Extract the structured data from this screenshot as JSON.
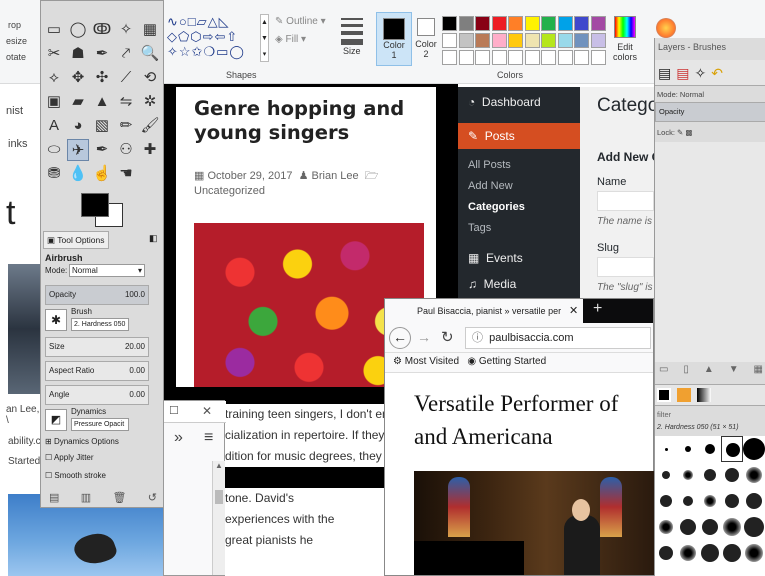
{
  "paint": {
    "left_partial_labels": [
      "rop",
      "esize",
      "otate"
    ],
    "shapes_label": "Shapes",
    "outline_label": "Outline",
    "fill_label": "Fill",
    "size_label": "Size",
    "color1_label": "Color",
    "color1_num": "1",
    "color2_label": "Color",
    "color2_num": "2",
    "colors_label": "Colors",
    "edit_colors_label": "Edit",
    "edit_colors_label2": "colors",
    "palette_row1": [
      "#000000",
      "#7f7f7f",
      "#880015",
      "#ed1c24",
      "#ff7f27",
      "#fff200",
      "#22b14c",
      "#00a2e8",
      "#3f48cc",
      "#a349a4"
    ],
    "palette_row2": [
      "#ffffff",
      "#c3c3c3",
      "#b97a57",
      "#ffaec9",
      "#ffc90e",
      "#efe4b0",
      "#b5e61d",
      "#99d9ea",
      "#7092be",
      "#c8bfe7"
    ]
  },
  "leftstrip": {
    "texts": [
      "nist",
      "inks",
      "t",
      "an Lee, \\",
      "ability.c",
      "Started"
    ]
  },
  "gimp": {
    "tool_options_tab": "Tool Options",
    "tool_name": "Airbrush",
    "mode_label": "Mode:",
    "mode_value": "Normal",
    "opacity_label": "Opacity",
    "opacity_value": "100.0",
    "brush_label": "Brush",
    "brush_value": "2. Hardness 050",
    "size_label": "Size",
    "size_value": "20.00",
    "aspect_label": "Aspect Ratio",
    "aspect_value": "0.00",
    "angle_label": "Angle",
    "angle_value": "0.00",
    "dynamics_label": "Dynamics",
    "dynamics_value": "Pressure Opacit",
    "dynamics_options": "Dynamics Options",
    "apply_jitter": "Apply Jitter",
    "smooth_stroke": "Smooth stroke"
  },
  "blog": {
    "title": "Genre hopping and young singers",
    "date": "October 29, 2017",
    "author": "Brian Lee",
    "category": "Uncategorized",
    "body1": "training teen singers, I don't enc",
    "body2": "cialization in repertoire. If they ar",
    "body3": "dition for music degrees, they oft",
    "body4": "tone. David's",
    "body5": "experiences with the",
    "body6": "great pianists he"
  },
  "wp": {
    "dashboard": "Dashboard",
    "posts": "Posts",
    "all_posts": "All Posts",
    "add_new": "Add New",
    "categories": "Categories",
    "tags": "Tags",
    "events": "Events",
    "media": "Media",
    "page_title": "Catego",
    "add_new_heading": "Add New C",
    "name_label": "Name",
    "name_hint": "The name is",
    "slug_label": "Slug",
    "slug_hint": "The \"slug\" is"
  },
  "layers": {
    "title": "Layers - Brushes",
    "mode": "Mode: Normal",
    "opacity": "Opacity",
    "lock": "Lock:",
    "filter": "filter",
    "brush_name": "2. Hardness 050 (51 × 51)"
  },
  "firefox": {
    "tab_title": "Paul Bisaccia, pianist » versatile per",
    "url": "paulbisaccia.com",
    "bookmark1": "Most Visited",
    "bookmark2": "Getting Started",
    "heading1": "Versatile Performer of",
    "heading2": "and Americana"
  }
}
